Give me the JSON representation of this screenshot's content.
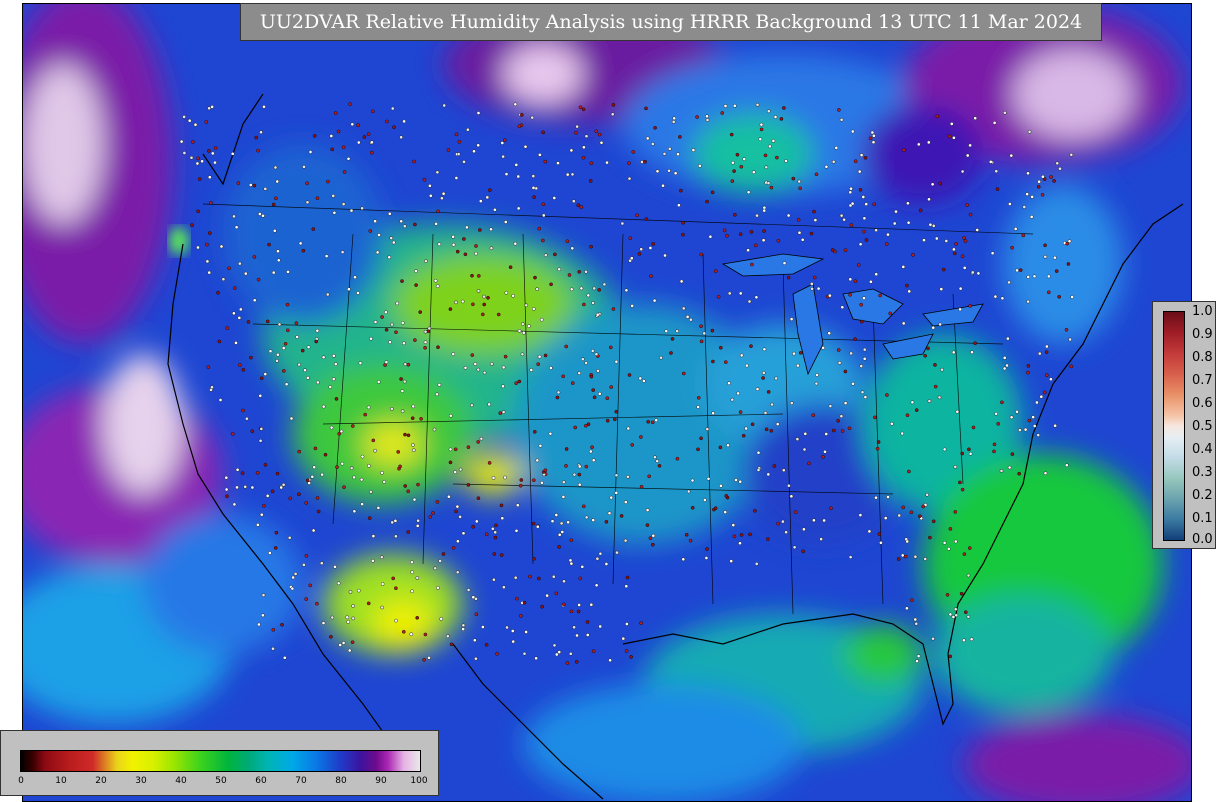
{
  "title": "UU2DVAR Relative Humidity Analysis using HRRR Background 13 UTC 11 Mar 2024",
  "innovation_colorbar": {
    "ticks": [
      "1.0",
      "0.9",
      "0.8",
      "0.7",
      "0.6",
      "0.5",
      "0.4",
      "0.3",
      "0.2",
      "0.1",
      "0.0"
    ]
  },
  "rh_colorbar": {
    "ticks": [
      "0",
      "10",
      "20",
      "30",
      "40",
      "50",
      "60",
      "70",
      "80",
      "90",
      "100"
    ]
  }
}
